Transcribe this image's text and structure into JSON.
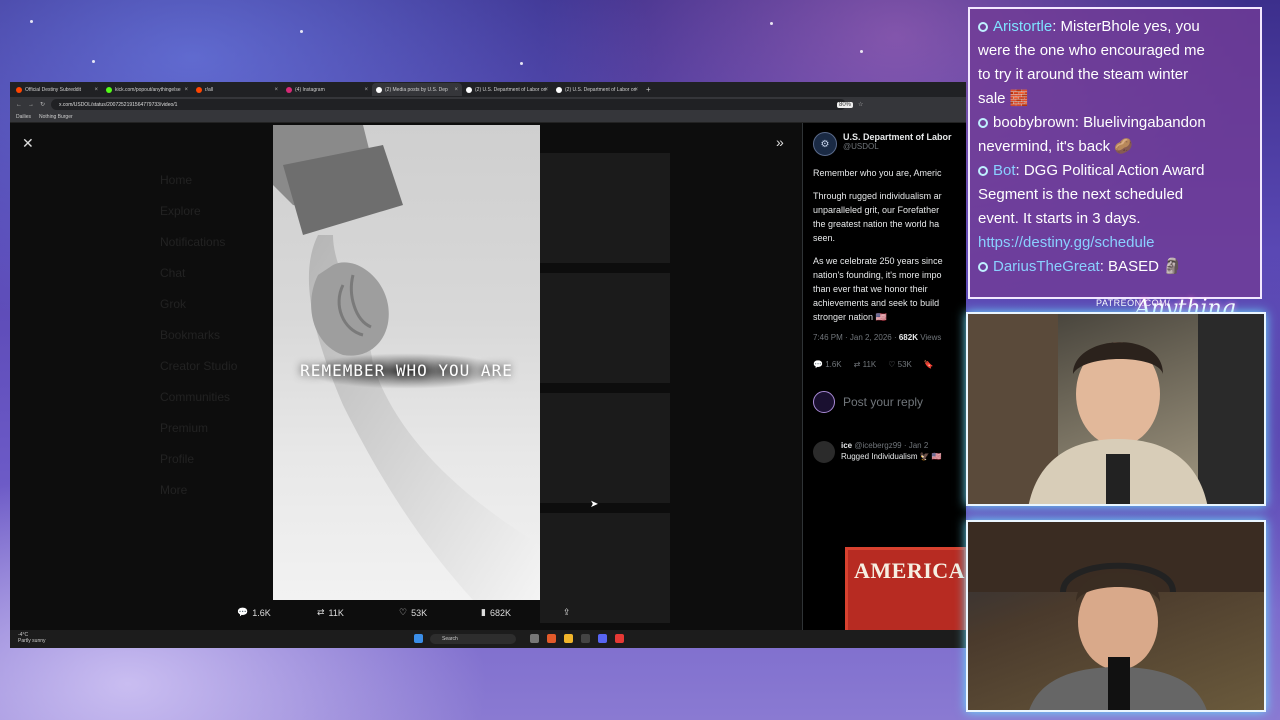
{
  "browser": {
    "tabs": [
      {
        "label": "Official Destiny Subreddit",
        "color": "#ff4500"
      },
      {
        "label": "kick.com/popout/anythingelse",
        "color": "#53fc18"
      },
      {
        "label": "r/all",
        "color": "#ff4500"
      },
      {
        "label": "(4) Instagram",
        "color": "#d62976"
      },
      {
        "label": "(2) Media posts by U.S. Dep",
        "color": "#ffffff"
      },
      {
        "label": "(2) U.S. Department of Labor on",
        "color": "#ffffff"
      },
      {
        "label": "(2) U.S. Department of Labor on",
        "color": "#ffffff"
      }
    ],
    "url": "x.com/USDOL/status/2007252191564779733/video/1",
    "zoom": "80%",
    "bookmarks": [
      "Dailies",
      "Nothing Burger"
    ]
  },
  "video": {
    "overlay_text": "REMEMBER WHO YOU ARE",
    "replies": "1.6K",
    "reposts": "11K",
    "likes": "53K",
    "views": "682K"
  },
  "tweet": {
    "name": "U.S. Department of Labor",
    "handle": "@USDOL",
    "line1": "Remember who you are, Americ",
    "para2": [
      "Through rugged individualism ar",
      "unparalleled grit, our Forefather",
      "the greatest nation the world ha",
      "seen."
    ],
    "para3": [
      "As we celebrate 250 years since",
      "nation's founding, it's more impo",
      "than ever that we honor their",
      "achievements and seek to build",
      "stronger nation 🇺🇸"
    ],
    "time": "7:46 PM · Jan 2, 2026 ·",
    "views": "682K",
    "views_label": "Views",
    "replies": "1.6K",
    "reposts": "11K",
    "likes": "53K",
    "reply_placeholder": "Post your reply",
    "reply_user": "ice",
    "reply_handle": "@icebergz99 · Jan 2",
    "reply_text": "Rugged Individualism 🦅 🇺🇸",
    "reply_image_text": "AMERICA"
  },
  "taskbar": {
    "temp": "-4°C",
    "weather": "Partly sunny",
    "search": "Search"
  },
  "chat": {
    "messages": [
      {
        "user": "Aristortle",
        "text": ": MisterBhole yes, you",
        "cont": [
          "were the one who encouraged me",
          "to try it around the steam winter",
          "sale 🧱"
        ]
      },
      {
        "user": "boobybrown",
        "text": ": Bluelivingabandon",
        "cont": [
          "nevermind, it's back 🥔"
        ]
      },
      {
        "user": "Bot",
        "text": ": DGG Political Action Award",
        "cont": [
          "Segment is the next scheduled",
          "event. It starts in 3 days."
        ],
        "link": "https://destiny.gg/schedule"
      },
      {
        "user": "DariusTheGreat",
        "text": ": BASED 🗿",
        "cont": []
      }
    ]
  },
  "overlay": {
    "patreon": "PATREON.COM/",
    "logo": "Anything Else?"
  },
  "ghost_nav": [
    "Home",
    "Explore",
    "Notifications",
    "Chat",
    "Grok",
    "Bookmarks",
    "Creator Studio",
    "Communities",
    "Premium",
    "Profile",
    "More"
  ]
}
